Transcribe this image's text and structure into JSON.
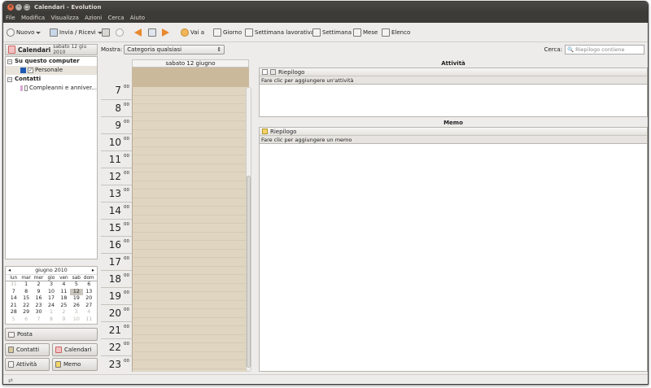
{
  "window": {
    "title": "Calendari - Evolution"
  },
  "menu": [
    "File",
    "Modifica",
    "Visualizza",
    "Azioni",
    "Cerca",
    "Aiuto"
  ],
  "toolbar": {
    "new": "Nuovo",
    "send_receive": "Invia / Ricevi",
    "goto": "Vai a",
    "day": "Giorno",
    "work_week": "Settimana lavorativa",
    "week": "Settimana",
    "month": "Mese",
    "list": "Elenco"
  },
  "sidebar": {
    "header_title": "Calendari",
    "header_date": "sabato 12 giu 2010",
    "groups": [
      {
        "label": "Su questo computer",
        "items": [
          {
            "label": "Personale",
            "color": "#1e59b4",
            "checked": true
          }
        ]
      },
      {
        "label": "Contatti",
        "items": [
          {
            "label": "Compleanni e anniver...",
            "color": "#d9a9d4",
            "checked": false
          }
        ]
      }
    ]
  },
  "minical": {
    "month_label": "giugno 2010",
    "weekdays": [
      "lun",
      "mar",
      "mer",
      "gio",
      "ven",
      "sab",
      "dom"
    ],
    "days": [
      [
        "31",
        "o"
      ],
      [
        "1",
        ""
      ],
      [
        "2",
        ""
      ],
      [
        "3",
        ""
      ],
      [
        "4",
        ""
      ],
      [
        "5",
        ""
      ],
      [
        "6",
        ""
      ],
      [
        "7",
        ""
      ],
      [
        "8",
        ""
      ],
      [
        "9",
        ""
      ],
      [
        "10",
        ""
      ],
      [
        "11",
        ""
      ],
      [
        "12",
        "t"
      ],
      [
        "13",
        ""
      ],
      [
        "14",
        ""
      ],
      [
        "15",
        ""
      ],
      [
        "16",
        ""
      ],
      [
        "17",
        ""
      ],
      [
        "18",
        ""
      ],
      [
        "19",
        ""
      ],
      [
        "20",
        ""
      ],
      [
        "21",
        ""
      ],
      [
        "22",
        ""
      ],
      [
        "23",
        ""
      ],
      [
        "24",
        ""
      ],
      [
        "25",
        ""
      ],
      [
        "26",
        ""
      ],
      [
        "27",
        ""
      ],
      [
        "28",
        ""
      ],
      [
        "29",
        ""
      ],
      [
        "30",
        ""
      ],
      [
        "1",
        "o"
      ],
      [
        "2",
        "o"
      ],
      [
        "3",
        "o"
      ],
      [
        "4",
        "o"
      ],
      [
        "5",
        "o"
      ],
      [
        "6",
        "o"
      ],
      [
        "7",
        "o"
      ],
      [
        "8",
        "o"
      ],
      [
        "9",
        "o"
      ],
      [
        "10",
        "o"
      ],
      [
        "11",
        "o"
      ]
    ]
  },
  "switcher": {
    "mail": "Posta",
    "contacts": "Contatti",
    "calendars": "Calendari",
    "tasks": "Attività",
    "memos": "Memo"
  },
  "dayview": {
    "show_label": "Mostra:",
    "category": "Categoria qualsiasi",
    "date_header": "sabato 12 giugno",
    "hours": [
      "7",
      "8",
      "9",
      "10",
      "11",
      "12",
      "13",
      "14",
      "15",
      "16",
      "17",
      "18",
      "19",
      "20",
      "21",
      "22",
      "23"
    ],
    "minutes": "00"
  },
  "search": {
    "label": "Cerca:",
    "placeholder": "Riepilogo contiene"
  },
  "tasks": {
    "title": "Attività",
    "column": "Riepilogo",
    "hint": "Fare clic per aggiungere un'attività"
  },
  "memos": {
    "title": "Memo",
    "column": "Riepilogo",
    "hint": "Fare clic per aggiungere un memo"
  }
}
